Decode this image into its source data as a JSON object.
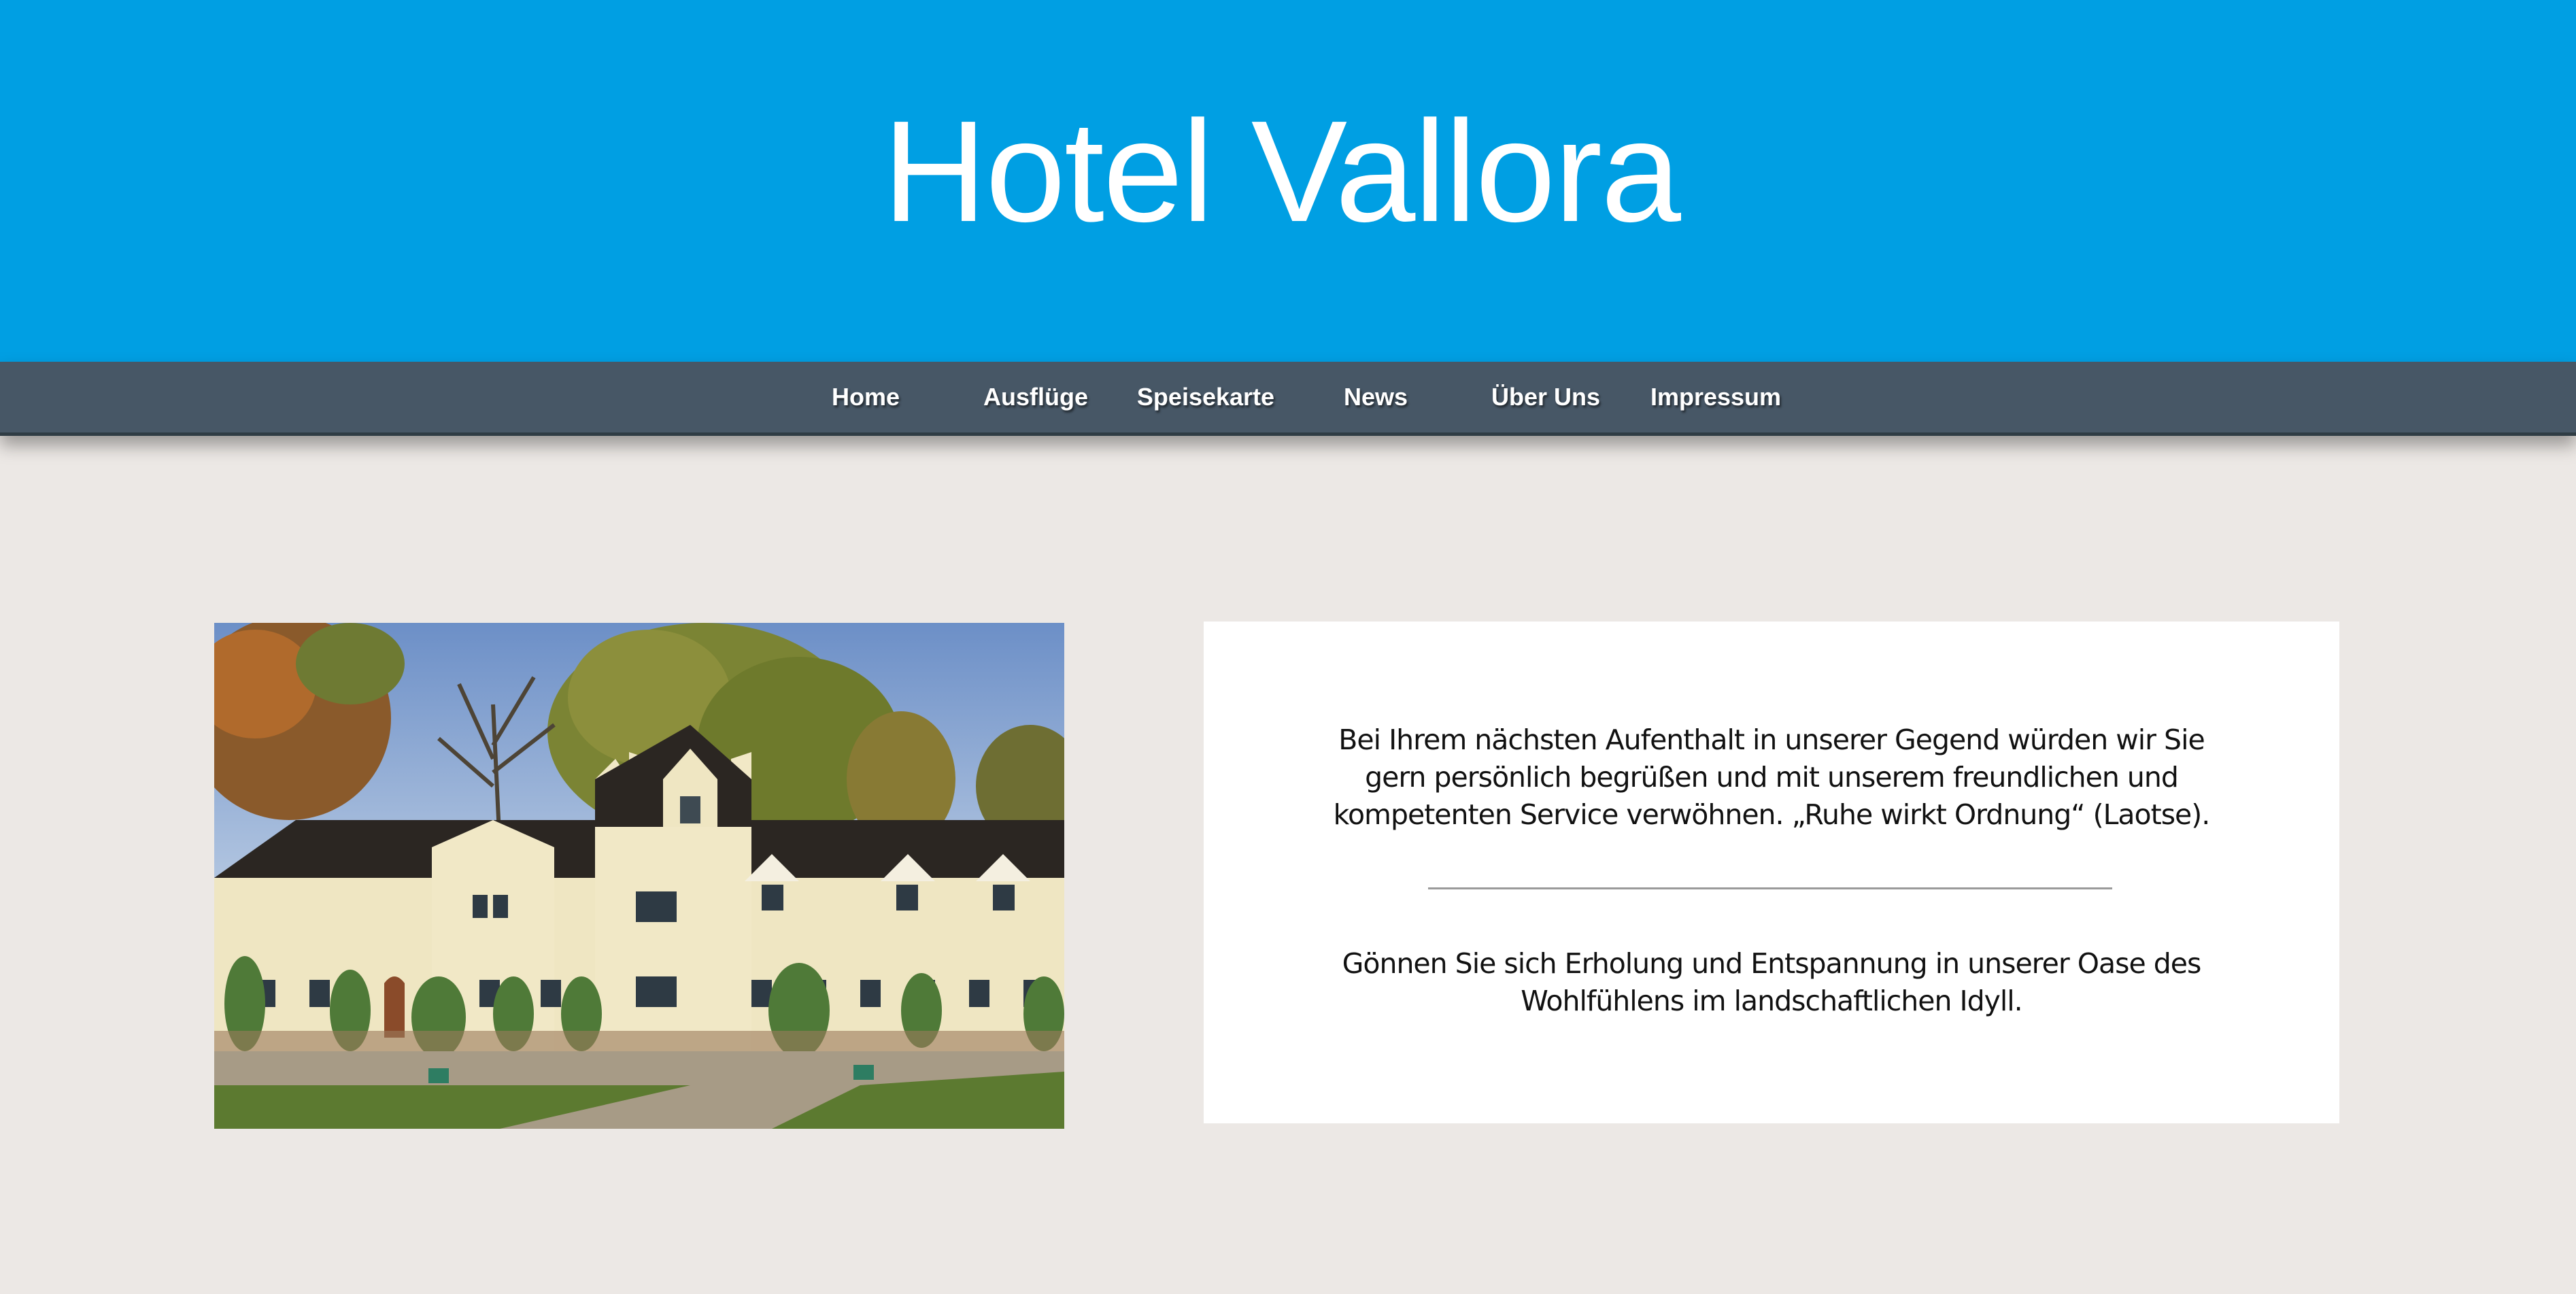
{
  "header": {
    "title": "Hotel Vallora",
    "background": "#009fe3"
  },
  "nav": {
    "background": "#475766",
    "items": [
      {
        "label": "Home"
      },
      {
        "label": "Ausflüge"
      },
      {
        "label": "Speisekarte"
      },
      {
        "label": "News"
      },
      {
        "label": "Über Uns"
      },
      {
        "label": "Impressum"
      }
    ]
  },
  "main": {
    "background": "#ece8e5",
    "photo": {
      "subject": "hotel building"
    },
    "intro": {
      "lines": [
        "Bei Ihrem nächsten Aufenthalt in unserer Gegend würden wir Sie",
        "gern persönlich begrüßen und mit unserem freundlichen und",
        "kompetenten Service verwöhnen. „Ruhe wirkt Ordnung“ (Laotse)."
      ]
    },
    "tagline": {
      "lines": [
        "Gönnen Sie sich Erholung und Entspannung in unserer Oase des",
        "Wohlfühlens im landschaftlichen Idyll."
      ]
    }
  }
}
